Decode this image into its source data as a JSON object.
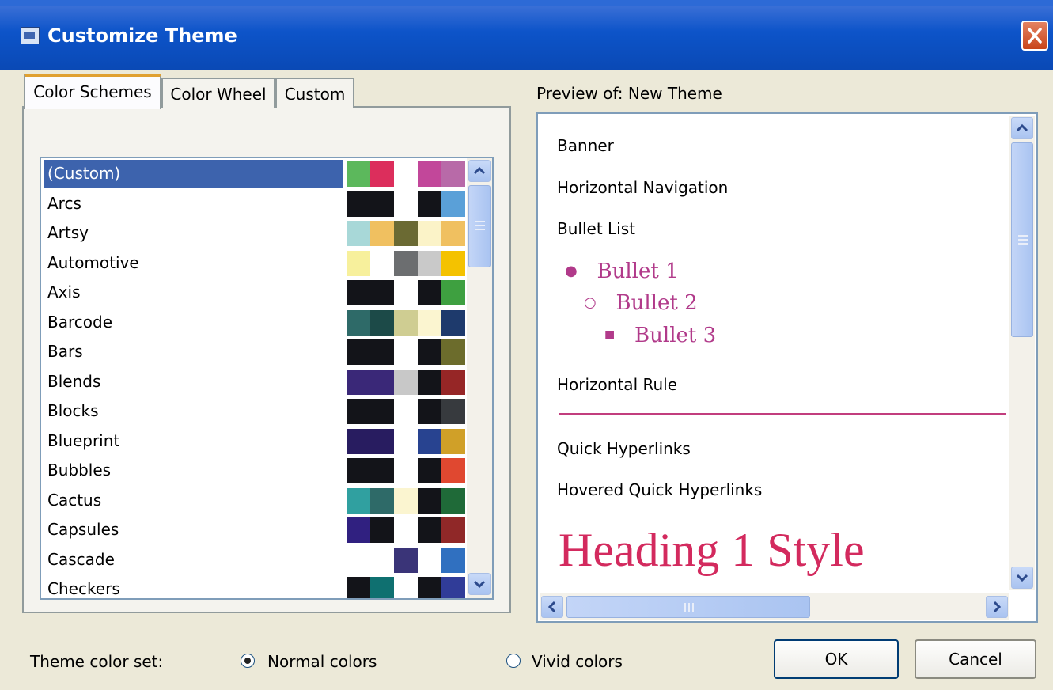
{
  "window": {
    "title": "Customize Theme"
  },
  "tabs": [
    {
      "label": "Color Schemes",
      "active": true
    },
    {
      "label": "Color Wheel",
      "active": false
    },
    {
      "label": "Custom",
      "active": false
    }
  ],
  "schemes": [
    {
      "label": "(Custom)",
      "selected": true,
      "swatches": [
        "#5cb85c",
        "#dc2e5c",
        "#ffffff",
        "#c2479a",
        "#b86aa8"
      ]
    },
    {
      "label": "Arcs",
      "swatches": [
        "#131419",
        "#131419",
        "#ffffff",
        "#131419",
        "#5aa0d8"
      ]
    },
    {
      "label": "Artsy",
      "swatches": [
        "#a8d8d8",
        "#f0c060",
        "#6b6a33",
        "#fbf3c8",
        "#f0c060"
      ]
    },
    {
      "label": "Automotive",
      "swatches": [
        "#f7f09c",
        "#ffffff",
        "#6c6e70",
        "#c9c9c9",
        "#f4c200"
      ]
    },
    {
      "label": "Axis",
      "swatches": [
        "#131419",
        "#131419",
        "#ffffff",
        "#131419",
        "#3ea040"
      ]
    },
    {
      "label": "Barcode",
      "swatches": [
        "#2e6a68",
        "#1c4a48",
        "#cfcd92",
        "#fbf5d0",
        "#1e3a6c"
      ]
    },
    {
      "label": "Bars",
      "swatches": [
        "#131419",
        "#131419",
        "#ffffff",
        "#131419",
        "#6c6c2c"
      ]
    },
    {
      "label": "Blends",
      "swatches": [
        "#3a2878",
        "#3a2878",
        "#c8c8c8",
        "#131419",
        "#962626"
      ]
    },
    {
      "label": "Blocks",
      "swatches": [
        "#131419",
        "#131419",
        "#ffffff",
        "#131419",
        "#373a3e"
      ]
    },
    {
      "label": "Blueprint",
      "swatches": [
        "#281c60",
        "#281c60",
        "#ffffff",
        "#284390",
        "#d0a028"
      ]
    },
    {
      "label": "Bubbles",
      "swatches": [
        "#131419",
        "#131419",
        "#ffffff",
        "#131419",
        "#e04830"
      ]
    },
    {
      "label": "Cactus",
      "swatches": [
        "#30a0a0",
        "#2e6a68",
        "#fbf5d0",
        "#131419",
        "#1f6a38"
      ]
    },
    {
      "label": "Capsules",
      "swatches": [
        "#302080",
        "#131419",
        "#ffffff",
        "#131419",
        "#902828"
      ]
    },
    {
      "label": "Cascade",
      "swatches": [
        "#ffffff",
        "#ffffff",
        "#3a3478",
        "#ffffff",
        "#3070c0"
      ]
    },
    {
      "label": "Checkers",
      "swatches": [
        "#131419",
        "#0f7070",
        "#ffffff",
        "#131419",
        "#303c98"
      ]
    }
  ],
  "preview": {
    "label": "Preview of: New Theme",
    "banner": "Banner",
    "horizontal_navigation": "Horizontal Navigation",
    "bullet_list": "Bullet List",
    "bullets": [
      "Bullet 1",
      "Bullet 2",
      "Bullet 3"
    ],
    "horizontal_rule": "Horizontal Rule",
    "quick_hyperlinks": "Quick Hyperlinks",
    "hovered_quick_hyperlinks": "Hovered Quick Hyperlinks",
    "heading1": "Heading 1 Style"
  },
  "footer": {
    "color_set_label": "Theme color set:",
    "normal_label": "Normal colors",
    "vivid_label": "Vivid colors",
    "selected": "normal"
  },
  "buttons": {
    "ok": "OK",
    "cancel": "Cancel"
  },
  "colors": {
    "accent": "#c23e7e",
    "heading": "#d32a5e",
    "selection": "#3d63ad"
  }
}
